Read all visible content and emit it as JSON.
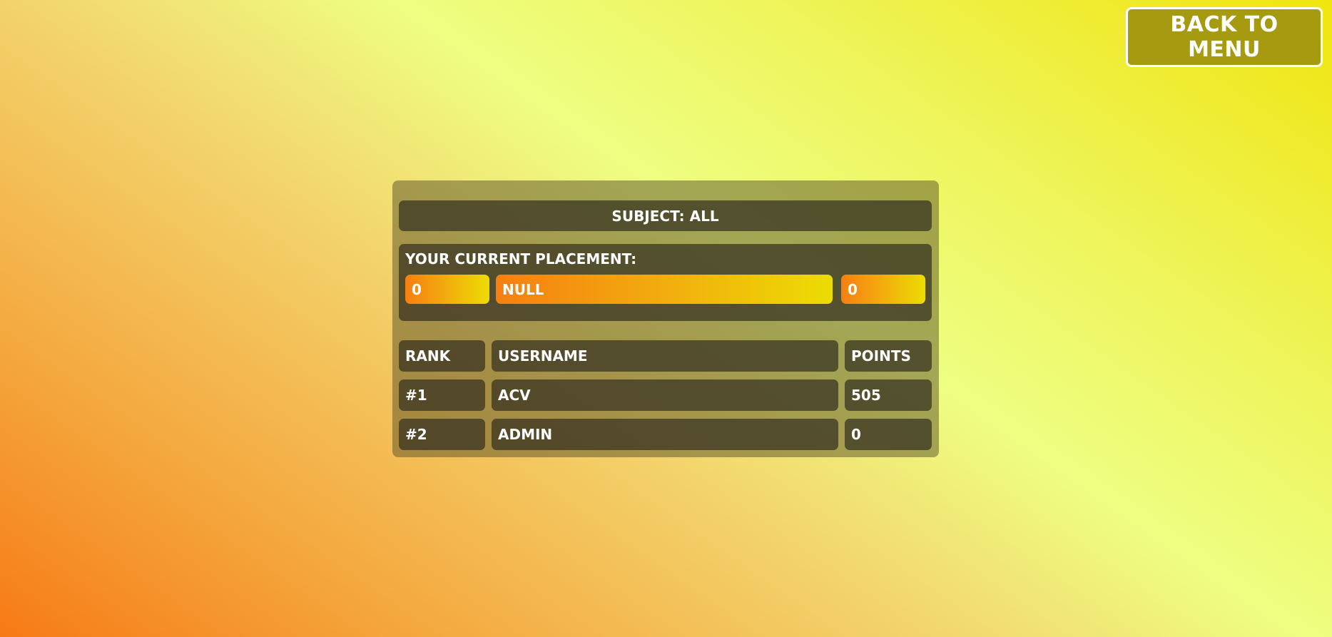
{
  "header": {
    "back_button_label": "BACK TO MENU"
  },
  "leaderboard": {
    "subject_label": "SUBJECT: ALL",
    "placement": {
      "title": "YOUR CURRENT PLACEMENT:",
      "rank": "0",
      "username": "NULL",
      "points": "0"
    },
    "columns": {
      "rank": "RANK",
      "username": "USERNAME",
      "points": "POINTS"
    },
    "rows": [
      {
        "rank": "#1",
        "username": "ACV",
        "points": "505"
      },
      {
        "rank": "#2",
        "username": "ADMIN",
        "points": "0"
      }
    ]
  },
  "colors": {
    "button_bg": "#a69a10",
    "pill_start": "#f67f12",
    "pill_end": "#ecdc03"
  }
}
